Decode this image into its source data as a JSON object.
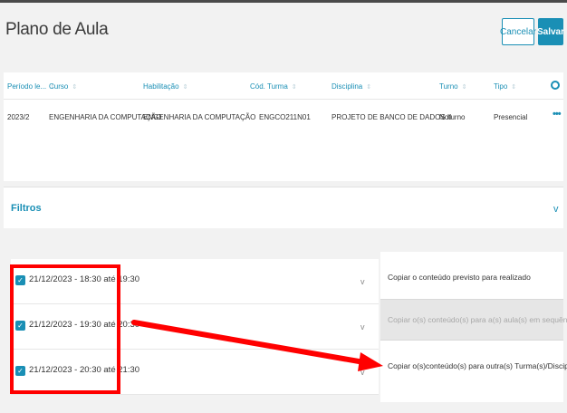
{
  "header": {
    "title": "Plano de Aula",
    "cancel_label": "Cancelar",
    "save_label": "Salvar"
  },
  "table": {
    "columns": [
      "Período le...",
      "Curso",
      "Habilitação",
      "Cód. Turma",
      "Disciplina",
      "Turno",
      "Tipo"
    ],
    "rows": [
      [
        "2023/2",
        "ENGENHARIA DA COMPUTAÇÃO",
        "ENGENHARIA DA COMPUTAÇÃO",
        "ENGCO211N01",
        "PROJETO DE BANCO DE DADOS II",
        "Noturno",
        "Presencial"
      ]
    ],
    "settings_icon": "gear-icon",
    "row_menu_icon": "more-horizontal-icon",
    "more_glyph": "•••"
  },
  "filters": {
    "label": "Filtros",
    "chevron": "v"
  },
  "lessons": {
    "items": [
      {
        "label": "21/12/2023 - 18:30 até 19:30",
        "checked": true
      },
      {
        "label": "21/12/2023 - 19:30 até 20:30",
        "checked": true
      },
      {
        "label": "21/12/2023 - 20:30 até 21:30",
        "checked": true
      }
    ],
    "check_glyph": "✓",
    "row_chevron": "v"
  },
  "actions": {
    "items": [
      {
        "label": "Copiar o conteúdo previsto para realizado",
        "disabled": false
      },
      {
        "label": "Copiar o(s) conteúdo(s) para a(s) aula(s) em sequência",
        "disabled": true
      },
      {
        "label": "Copiar o(s)conteúdo(s) para outra(s) Turma(s)/Disciplina(s)",
        "disabled": false
      }
    ]
  },
  "colors": {
    "accent": "#1a8fb5",
    "annotation": "#ff0000"
  }
}
